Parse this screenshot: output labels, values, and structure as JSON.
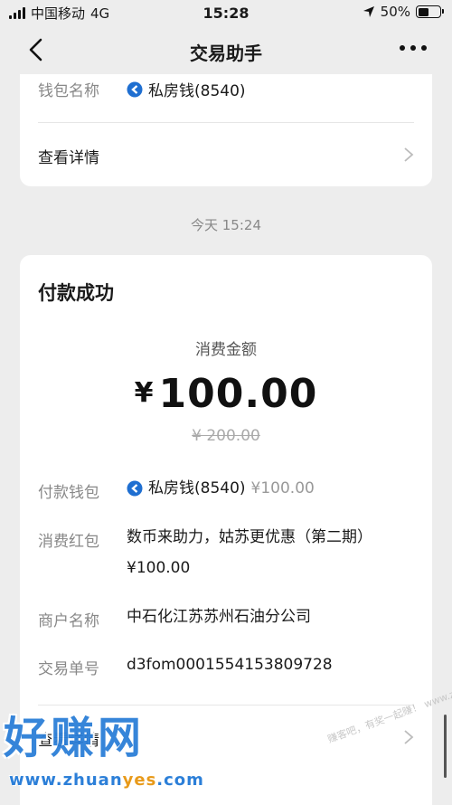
{
  "status_bar": {
    "carrier": "中国移动",
    "network": "4G",
    "time": "15:28",
    "battery": "50%",
    "battery_level": 0.5
  },
  "nav": {
    "title": "交易助手"
  },
  "card1": {
    "wallet_label": "钱包名称",
    "wallet_value": "私房钱(8540)",
    "detail_link": "查看详情"
  },
  "timestamp": "今天 15:24",
  "card2": {
    "title": "付款成功",
    "amount_label": "消费金额",
    "currency": "¥",
    "amount": "100.00",
    "original_amount": "¥ 200.00",
    "rows": [
      {
        "label": "付款钱包",
        "wallet": "私房钱(8540)",
        "extra": "¥100.00"
      },
      {
        "label": "消费红包",
        "line1": "数币来助力，姑苏更优惠（第二期）",
        "line2": "¥100.00"
      },
      {
        "label": "商户名称",
        "value": "中石化江苏苏州石油分公司"
      },
      {
        "label": "交易单号",
        "value": "d3fom0001554153809728"
      }
    ],
    "detail_link": "查看详情"
  },
  "watermark": {
    "logo": "好赚网",
    "url_prefix": "www.zhuan",
    "url_highlight": "yes",
    "url_suffix": ".com",
    "slogan": "赚客吧，有奖一起赚！ www.zuanke8.com"
  },
  "colors": {
    "accent_yellow": "#e0a526",
    "wallet_blue": "#1f6fd1",
    "watermark_blue": "#2c7fd8"
  },
  "icons": [
    "back-icon",
    "more-icon",
    "wallet-icon",
    "chevron-right-icon",
    "location-icon",
    "signal-icon",
    "battery-icon"
  ]
}
